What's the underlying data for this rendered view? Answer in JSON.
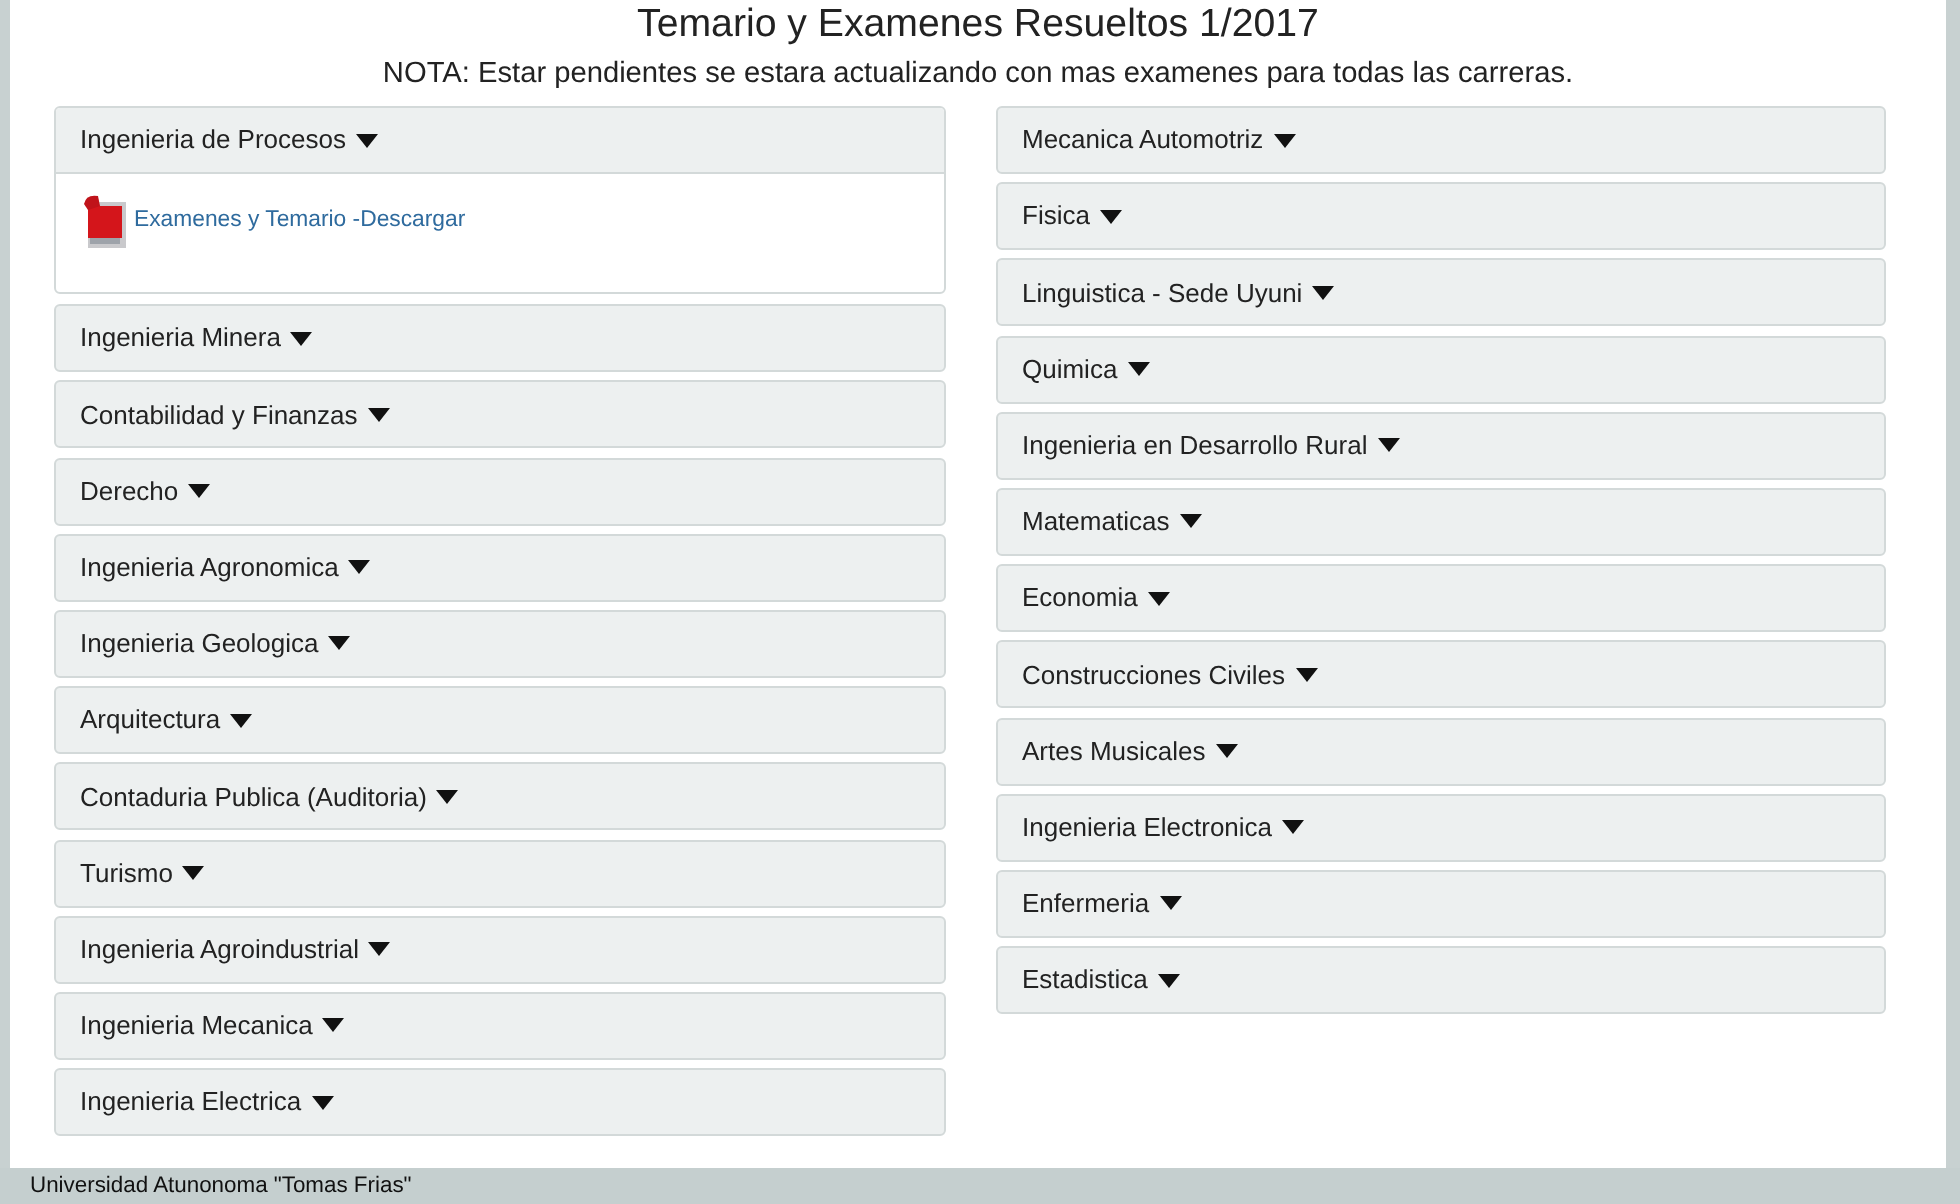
{
  "page": {
    "title": "Temario y Examenes Resueltos 1/2017",
    "note": "NOTA: Estar pendientes se estara actualizando con mas examenes para todas las carreras."
  },
  "columns": [
    {
      "panels": [
        {
          "title": "Ingenieria de Procesos",
          "expanded": true,
          "links": [
            {
              "label": "Examenes y Temario -Descargar"
            }
          ]
        },
        {
          "title": "Ingenieria Minera",
          "expanded": false
        },
        {
          "title": "Contabilidad y Finanzas",
          "expanded": false
        },
        {
          "title": "Derecho",
          "expanded": false
        },
        {
          "title": "Ingenieria Agronomica",
          "expanded": false
        },
        {
          "title": "Ingenieria Geologica",
          "expanded": false
        },
        {
          "title": "Arquitectura",
          "expanded": false
        },
        {
          "title": "Contaduria Publica (Auditoria)",
          "expanded": false
        },
        {
          "title": "Turismo",
          "expanded": false
        },
        {
          "title": "Ingenieria Agroindustrial",
          "expanded": false
        },
        {
          "title": "Ingenieria Mecanica",
          "expanded": false
        },
        {
          "title": "Ingenieria Electrica",
          "expanded": false
        }
      ]
    },
    {
      "panels": [
        {
          "title": "Mecanica Automotriz",
          "expanded": false
        },
        {
          "title": "Fisica",
          "expanded": false
        },
        {
          "title": "Linguistica - Sede Uyuni",
          "expanded": false
        },
        {
          "title": "Quimica",
          "expanded": false
        },
        {
          "title": "Ingenieria en Desarrollo Rural",
          "expanded": false
        },
        {
          "title": "Matematicas",
          "expanded": false
        },
        {
          "title": "Economia",
          "expanded": false
        },
        {
          "title": "Construcciones Civiles",
          "expanded": false
        },
        {
          "title": "Artes Musicales",
          "expanded": false
        },
        {
          "title": "Ingenieria Electronica",
          "expanded": false
        },
        {
          "title": "Enfermeria",
          "expanded": false
        },
        {
          "title": "Estadistica",
          "expanded": false
        }
      ]
    }
  ],
  "footer": {
    "text": "Universidad Atunonoma \"Tomas Frias\""
  }
}
